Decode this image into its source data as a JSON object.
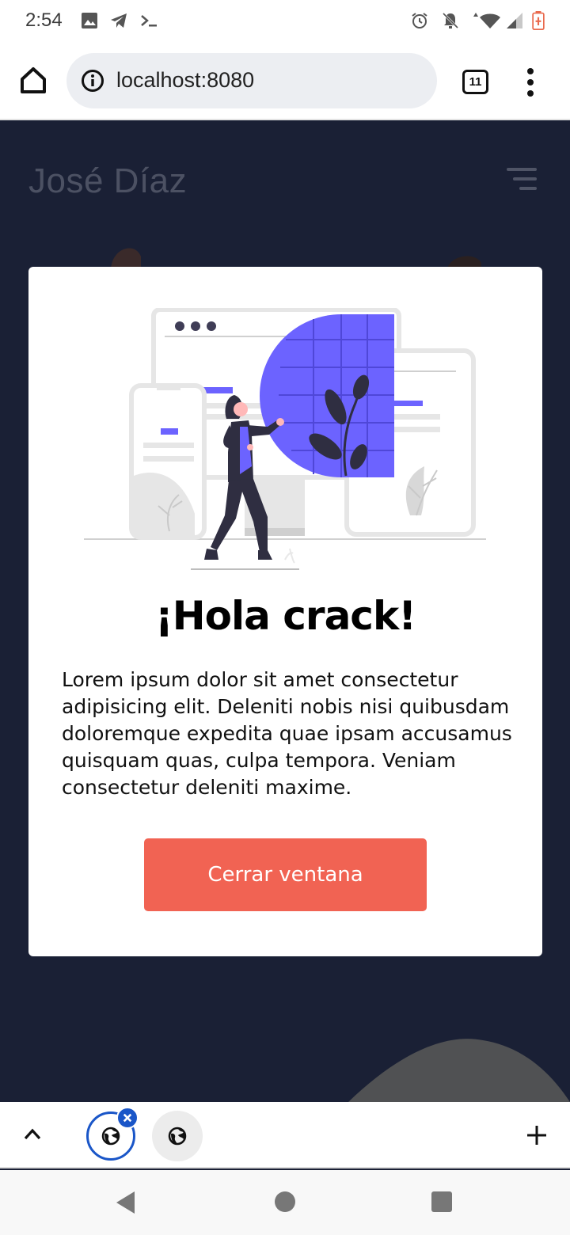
{
  "status_bar": {
    "time": "2:54",
    "left_icons": [
      "image-icon",
      "telegram-icon",
      "terminal-icon"
    ],
    "right_icons": [
      "alarm-icon",
      "notifications-off-icon",
      "wifi-icon",
      "signal-icon",
      "battery-icon"
    ]
  },
  "browser": {
    "url": "localhost:8080",
    "tab_count": "11"
  },
  "page": {
    "site_title": "José Díaz",
    "modal": {
      "title": "¡Hola crack!",
      "body": "Lorem ipsum dolor sit amet consectetur adipisicing elit. Deleniti nobis nisi quibusdam doloremque expedita quae ipsam accusamus quisquam quas, culpa tempora. Veniam consectetur deleniti maxime.",
      "button_label": "Cerrar ventana"
    }
  },
  "colors": {
    "page_background": "#1a2035",
    "button": "#f16353",
    "illustration_accent": "#6c63ff",
    "tab_active": "#1a56c8"
  }
}
